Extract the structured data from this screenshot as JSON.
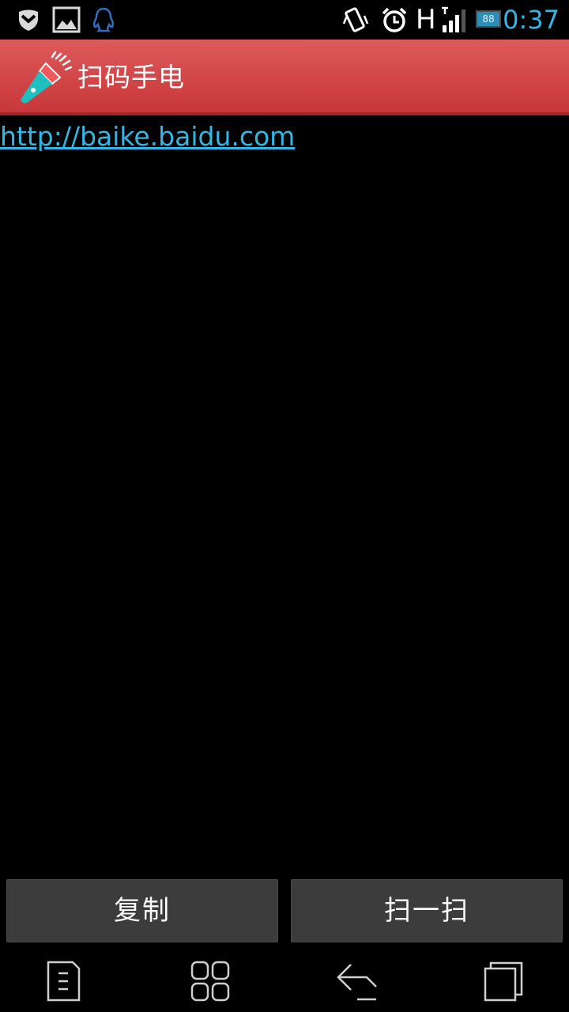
{
  "status_bar": {
    "time": "0:37",
    "network_type": "H",
    "battery_level": "88",
    "accent_color": "#33b5e5",
    "icons": [
      "shield-icon",
      "image-icon",
      "qq-icon",
      "vibrate-icon",
      "alarm-icon",
      "signal-icon",
      "battery-icon"
    ]
  },
  "title_bar": {
    "title": "扫码手电",
    "logo_icon": "flashlight-icon",
    "background_color": "#d24648"
  },
  "content": {
    "result_url": "http://baike.baidu.com",
    "link_color": "#33b5e5"
  },
  "actions": {
    "copy_label": "复制",
    "scan_label": "扫一扫"
  },
  "nav_bar": {
    "icons": [
      "menu-icon",
      "apps-icon",
      "back-icon",
      "recent-apps-icon"
    ]
  }
}
